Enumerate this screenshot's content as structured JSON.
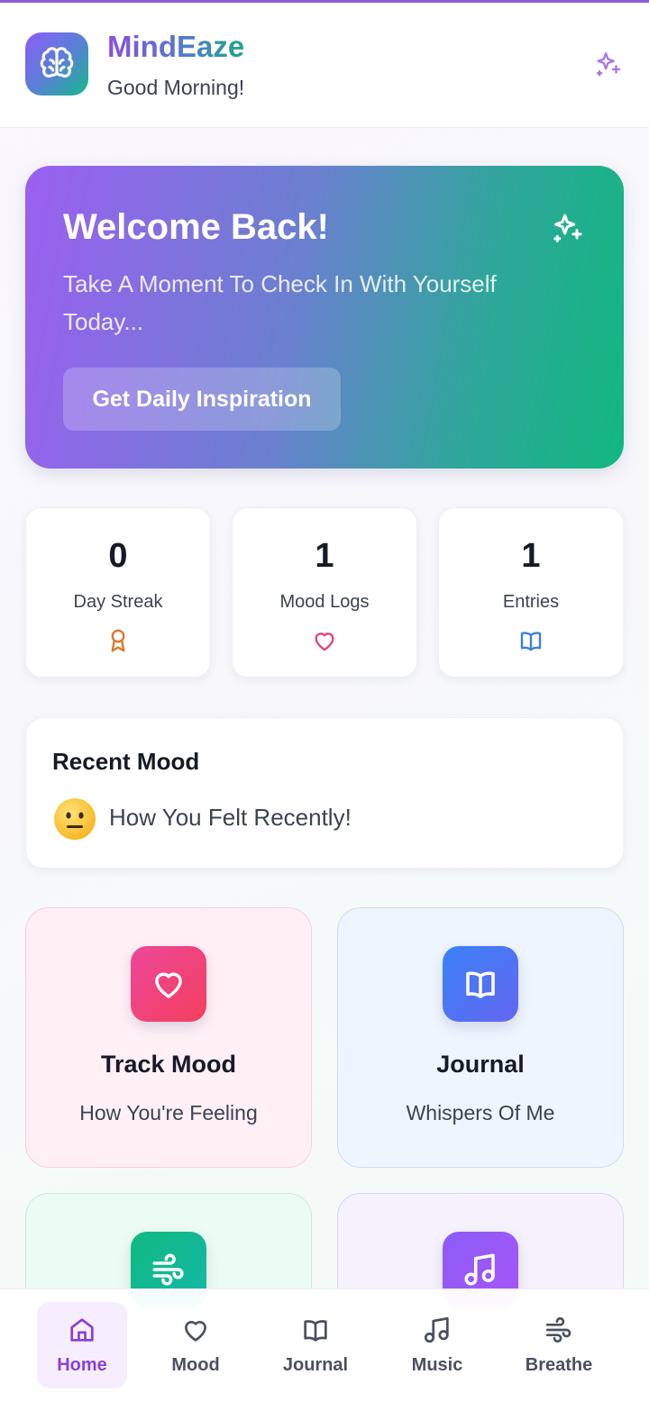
{
  "header": {
    "app_name": "MindEaze",
    "greeting": "Good Morning!",
    "logo_icon": "brain-icon",
    "action_icon": "sparkles-icon"
  },
  "welcome": {
    "title": "Welcome Back!",
    "text": "Take A Moment To Check In With Yourself Today...",
    "button_label": "Get Daily Inspiration",
    "icon": "sparkles-icon"
  },
  "stats": [
    {
      "value": "0",
      "label": "Day Streak",
      "icon": "award-icon",
      "color": "#e0772a"
    },
    {
      "value": "1",
      "label": "Mood Logs",
      "icon": "heart-icon",
      "color": "#e0457f"
    },
    {
      "value": "1",
      "label": "Entries",
      "icon": "book-icon",
      "color": "#3d7fdc"
    }
  ],
  "recent_mood": {
    "title": "Recent Mood",
    "emoji": "neutral-face-emoji",
    "text": "How You Felt Recently!"
  },
  "features": [
    {
      "title": "Track Mood",
      "subtitle": "How You're Feeling",
      "icon": "heart-icon",
      "color_from": "#ec4899",
      "color_to": "#f43f5e"
    },
    {
      "title": "Journal",
      "subtitle": "Whispers Of Me",
      "icon": "book-icon",
      "color_from": "#3b82f6",
      "color_to": "#6366f1"
    },
    {
      "icon": "wind-icon",
      "color_from": "#10b981",
      "color_to": "#14b8a6"
    },
    {
      "icon": "music-icon",
      "color_from": "#8b5cf6",
      "color_to": "#a855f7"
    }
  ],
  "bottom_nav": [
    {
      "label": "Home",
      "icon": "home-icon",
      "active": true
    },
    {
      "label": "Mood",
      "icon": "heart-icon",
      "active": false
    },
    {
      "label": "Journal",
      "icon": "book-icon",
      "active": false
    },
    {
      "label": "Music",
      "icon": "music-icon",
      "active": false
    },
    {
      "label": "Breathe",
      "icon": "wind-icon",
      "active": false
    }
  ],
  "colors": {
    "brand_purple": "#8a3fd6",
    "brand_green": "#12b77f",
    "active_nav_bg": "#f6eefe"
  }
}
